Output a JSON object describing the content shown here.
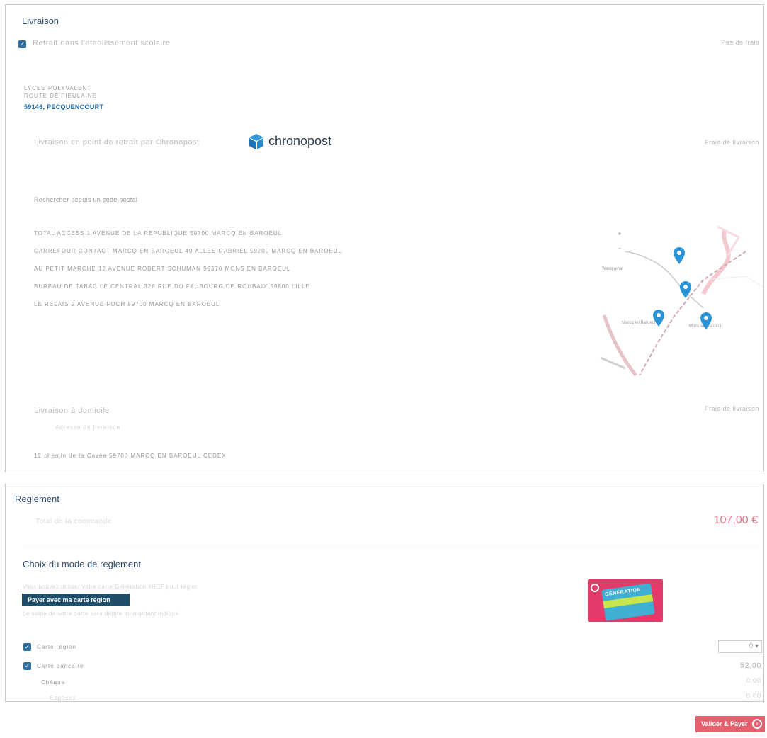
{
  "livraison": {
    "title": "Livraison",
    "option_etablissement": {
      "label": "Retrait dans l'établissement scolaire",
      "price": "Pas de frais",
      "address_line1": "LYCEE POLYVALENT",
      "address_line2": "ROUTE DE FIEULAINE",
      "address_city": "59146, PECQUENCOURT"
    },
    "option_chronopost": {
      "label": "Livraison en point de retrait par Chronopost",
      "brand": "chronopost",
      "price": "Frais de livraison",
      "search_placeholder": "Rechercher depuis un code postal",
      "points": [
        "TOTAL ACCESS 1 AVENUE DE LA REPUBLIQUE 59700 MARCQ EN BAROEUL",
        "CARREFOUR CONTACT MARCQ EN BAROEUL 40 ALLEE GABRIEL 59700 MARCQ EN BAROEUL",
        "AU PETIT MARCHE 12 AVENUE ROBERT SCHUMAN 59370 MONS EN BAROEUL",
        "BUREAU DE TABAC LE CENTRAL 326 RUE DU FAUBOURG DE ROUBAIX 59800 LILLE",
        "LE RELAIS 2 AVENUE FOCH 59700 MARCQ EN BAROEUL"
      ],
      "map_label_1": "Wasquehal",
      "map_label_2": "Marcq en Baroeul",
      "map_label_3": "Mons en Baroeul"
    },
    "option_domicile": {
      "label": "Livraison à domicile",
      "price": "Frais de livraison",
      "sub": "Adresse de livraison",
      "address": "12 chemin de la Cavée 59700 MARCQ EN BAROEUL CEDEX"
    }
  },
  "reglement": {
    "title": "Reglement",
    "total_label": "Total de la commande",
    "total_value": "107,00 €",
    "choix_title": "Choix du mode de reglement",
    "region_text_1": "Vous pouvez utiliser votre carte Génération #HDF pour régler",
    "region_button": "Payer avec ma carte région",
    "region_text_2": "Le solde de votre carte sera débité du montant indiqué",
    "card_label": "GÉNÉRATION",
    "methods": [
      {
        "label": "Carte région",
        "checked": true,
        "value": "0"
      },
      {
        "label": "Carte bancaire",
        "checked": true,
        "value": "52,00"
      },
      {
        "label": "Chèque",
        "checked": false,
        "value": "0,00"
      },
      {
        "label": "Espèces",
        "checked": false,
        "value": "0,00"
      }
    ]
  },
  "actions": {
    "pay_button": "Valider & Payer"
  },
  "colors": {
    "accent": "#2e6fa0",
    "pay": "#e4606e",
    "region_button": "#1f4f68",
    "total": "#e0738a"
  }
}
